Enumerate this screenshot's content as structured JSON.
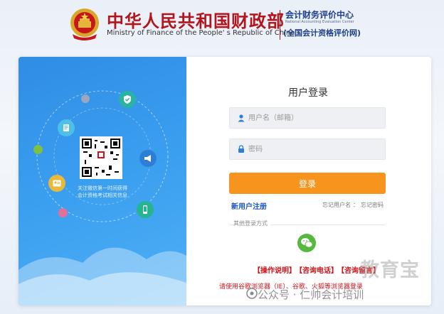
{
  "header": {
    "ministry_cn": "中华人民共和国财政部",
    "ministry_en": "Ministry of Finance of the People' s Republic of China",
    "center_cn": "会计财务评价中心",
    "center_en": "National Accounting Evaluation Center",
    "center_subtitle": "(全国会计资格评价网)"
  },
  "left_panel": {
    "qr_caption_line1": "关注微信第一时间获得",
    "qr_caption_line2": "会计资格考试相关信息",
    "icons": [
      "shield-check-icon",
      "document-icon",
      "megaphone-icon",
      "person-badge-icon",
      "mobile-phone-icon"
    ]
  },
  "login": {
    "title": "用户登录",
    "username_placeholder": "用户名（邮箱）",
    "password_placeholder": "密码",
    "login_button": "登录",
    "register_link": "新用户注册",
    "forgot_username": "忘记用户名",
    "forgot_separator": "：",
    "forgot_password": "忘记密码",
    "other_methods_label": "其他登录方式"
  },
  "links": {
    "manual": "【操作说明】",
    "phone": "【咨询电话】",
    "consult": "【咨询留言】"
  },
  "notice": "请使用谷歌浏览器（IE）、谷歌、火狐等浏览器登录",
  "watermark": {
    "brand": "教育宝",
    "line": "公众号 · 仁帅会计培训"
  },
  "colors": {
    "ministry_red": "#b4141b",
    "accent_orange": "#f7941d",
    "link_blue": "#1c56b8",
    "panel_blue": "#3b9ff0",
    "wechat_green": "#56b83c"
  }
}
